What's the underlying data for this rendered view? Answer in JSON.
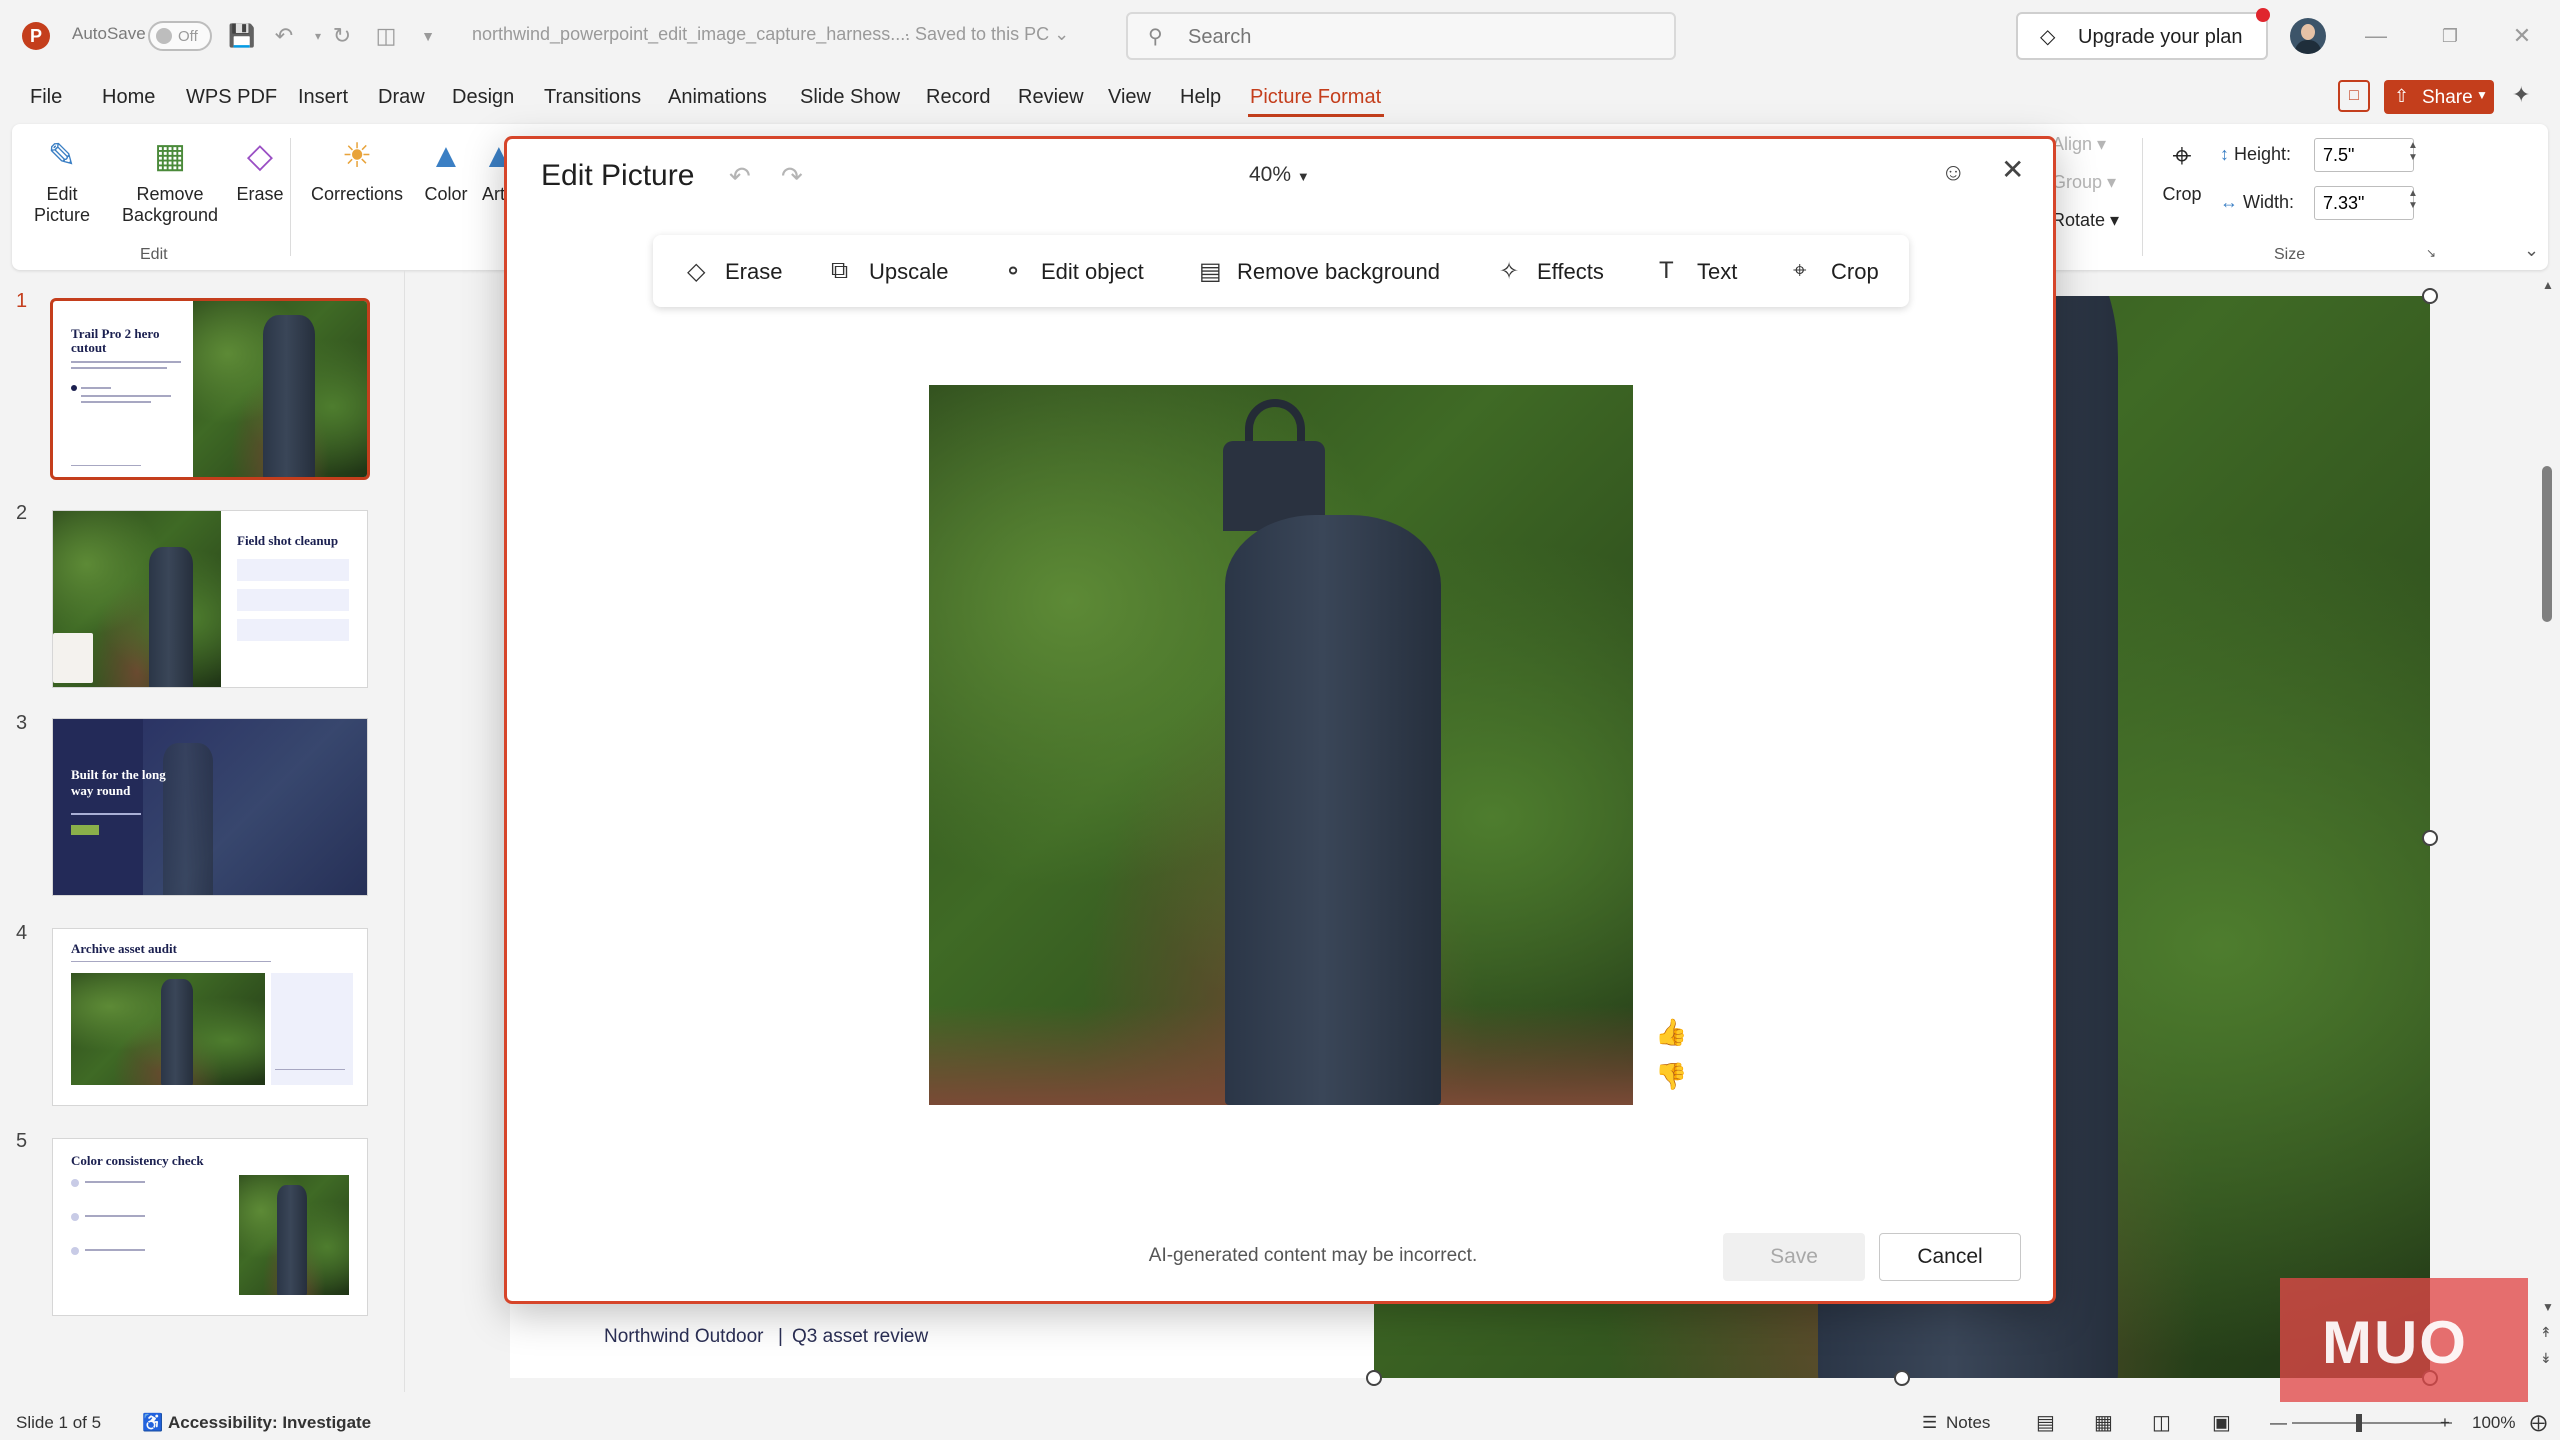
{
  "titlebar": {
    "autosave_label": "AutoSave",
    "autosave_state": "Off",
    "doc_title": "northwind_powerpoint_edit_image_capture_harness....",
    "saved_status": "Saved to this PC",
    "search_placeholder": "Search",
    "upgrade_label": "Upgrade your plan"
  },
  "menu": {
    "tabs": [
      "File",
      "Home",
      "WPS PDF",
      "Insert",
      "Draw",
      "Design",
      "Transitions",
      "Animations",
      "Slide Show",
      "Record",
      "Review",
      "View",
      "Help",
      "Picture Format"
    ],
    "active_tab": "Picture Format",
    "share_label": "Share"
  },
  "ribbon": {
    "edit_picture": "Edit Picture",
    "remove_background": "Remove Background",
    "erase": "Erase",
    "edit_group": "Edit",
    "corrections": "Corrections",
    "color": "Color",
    "artistic_effects": "Artistic Effects",
    "align": "Align",
    "group": "Group",
    "rotate": "Rotate",
    "crop": "Crop",
    "height_label": "Height:",
    "height_value": "7.5\"",
    "width_label": "Width:",
    "width_value": "7.33\"",
    "size_group": "Size"
  },
  "slides": [
    {
      "number": "1",
      "title": "Trail Pro 2 hero cutout"
    },
    {
      "number": "2",
      "title": "Field shot cleanup"
    },
    {
      "number": "3",
      "title": "Built for the long way round"
    },
    {
      "number": "4",
      "title": "Archive asset audit"
    },
    {
      "number": "5",
      "title": "Color consistency check"
    }
  ],
  "slide_footer": {
    "brand": "Northwind Outdoor",
    "separator": "|",
    "subtitle": "Q3 asset review"
  },
  "dialog": {
    "title": "Edit Picture",
    "zoom": "40%",
    "tools": [
      "Erase",
      "Upscale",
      "Edit object",
      "Remove background",
      "Effects",
      "Text",
      "Crop"
    ],
    "disclaimer": "AI-generated content may be incorrect.",
    "save_label": "Save",
    "cancel_label": "Cancel"
  },
  "statusbar": {
    "slide_indicator": "Slide 1 of 5",
    "accessibility": "Accessibility: Investigate",
    "notes": "Notes",
    "zoom": "100%"
  },
  "watermark": {
    "text": "MUO"
  },
  "colors": {
    "accent": "#c43e1c",
    "dialog_border": "#d6452a",
    "navy": "#1b2050"
  }
}
